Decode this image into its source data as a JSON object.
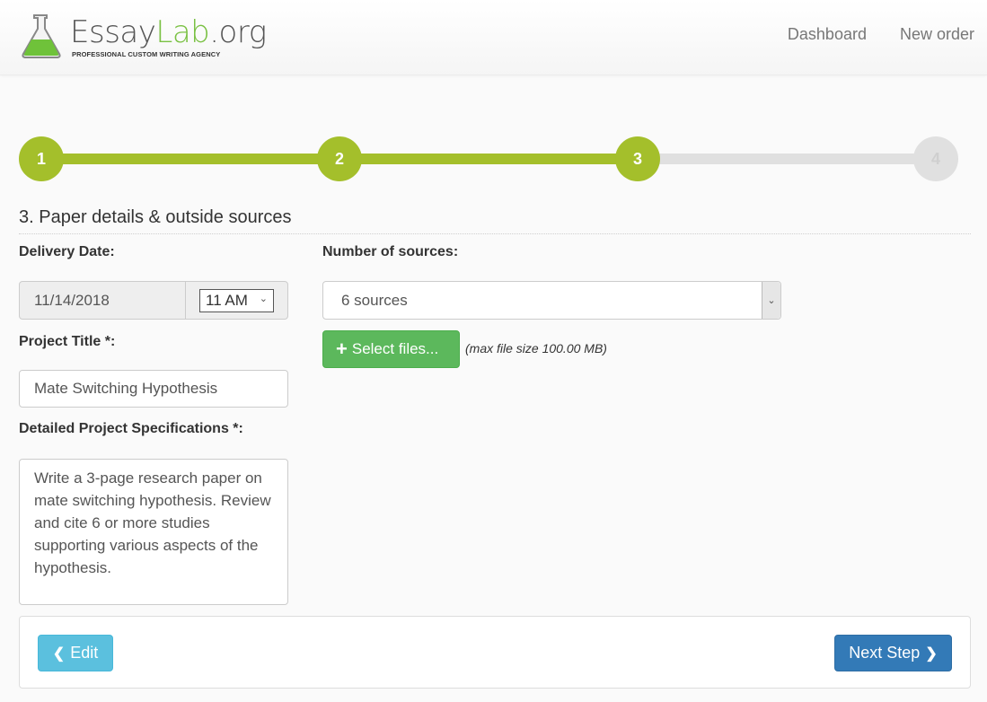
{
  "header": {
    "brand_prefix": "Essay",
    "brand_lab": "Lab",
    "brand_suffix": ".org",
    "tagline": "PROFESSIONAL CUSTOM WRITING AGENCY",
    "nav": [
      {
        "label": "Dashboard"
      },
      {
        "label": "New order"
      }
    ]
  },
  "stepper": {
    "current_step": 3,
    "total_steps": 4,
    "steps": [
      {
        "label": "1",
        "state": "done"
      },
      {
        "label": "2",
        "state": "done"
      },
      {
        "label": "3",
        "state": "active"
      },
      {
        "label": "4",
        "state": "todo"
      }
    ],
    "colors": {
      "done": "#a4bf2b",
      "todo": "#e0e0e0"
    }
  },
  "section": {
    "title": "3. Paper details & outside sources"
  },
  "form": {
    "delivery_date_label": "Delivery Date:",
    "delivery_date_value": "11/14/2018",
    "delivery_time_value": "11 AM",
    "project_title_label": "Project Title *:",
    "project_title_value": "Mate Switching Hypothesis",
    "specs_label": "Detailed Project Specifications *:",
    "specs_value": "Write a 3-page research paper on mate switching hypothesis. Review and cite 6 or more studies supporting various aspects of the hypothesis.",
    "sources_label": "Number of sources:",
    "sources_value": "6 sources",
    "select_files_label": "Select files...",
    "max_file_size_note": "(max file size 100.00 MB)"
  },
  "footer": {
    "edit_label": "Edit",
    "next_label": "Next Step"
  },
  "icons": {
    "plus": "+",
    "chevron_left": "❮",
    "chevron_right": "❯",
    "chevron_down": "⌄"
  }
}
